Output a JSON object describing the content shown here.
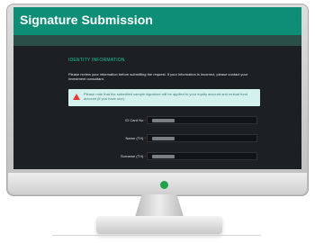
{
  "header": {
    "title": "Signature Submission"
  },
  "section": {
    "title": "IDENTITY INFORMATION"
  },
  "intro_text": "Please review your information before submitting the request. If your information is incorrect, please contact your investment consultant.",
  "notice": {
    "text": "Please note that the submitted sample signature will be applied to your equity account and mutual fund account (if you have one)."
  },
  "fields": [
    {
      "label": "ID Card No",
      "value": ""
    },
    {
      "label": "Name (TH)",
      "value": ""
    },
    {
      "label": "Surname (TH)",
      "value": ""
    }
  ],
  "required_marker": "*",
  "colors": {
    "header": "#0f8e77",
    "accent": "#20c4a0",
    "notice_bg": "#d4f1ee",
    "warning": "#e53935",
    "power_led": "#1fa24a"
  },
  "icons": {
    "notice": "warning-icon"
  }
}
